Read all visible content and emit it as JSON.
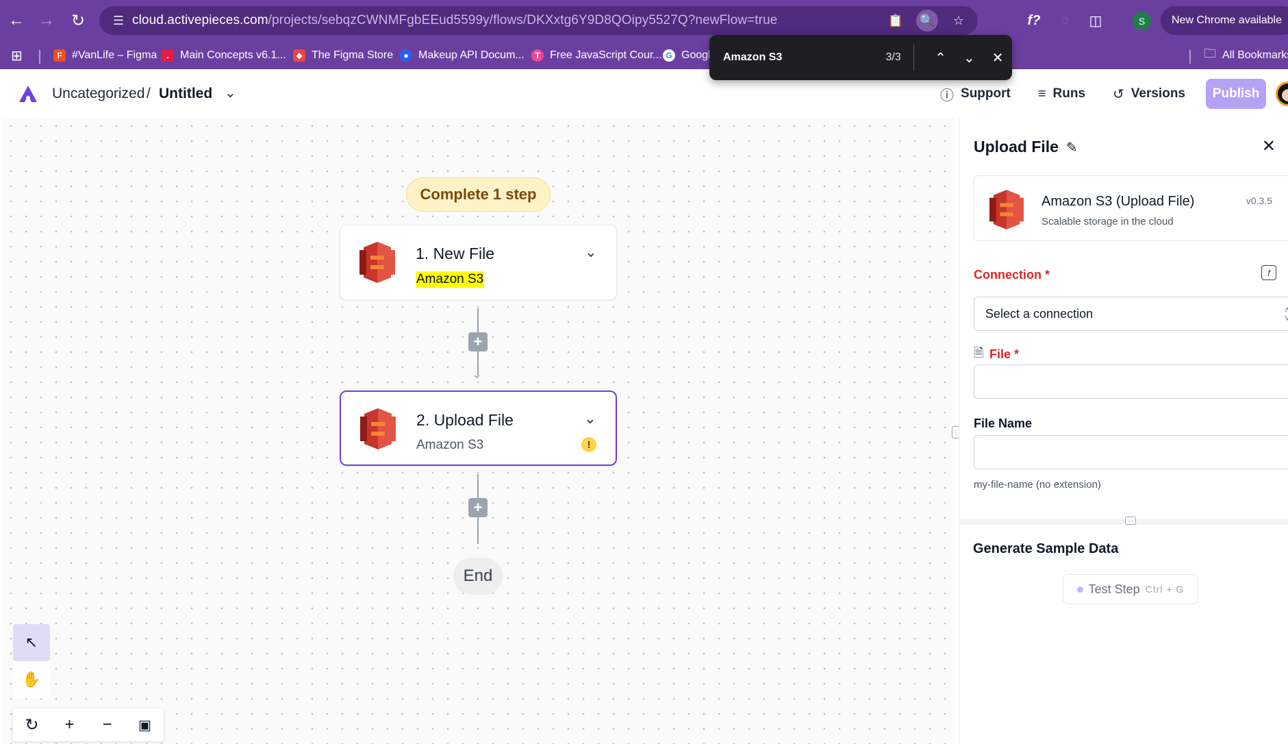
{
  "browser": {
    "url_host": "cloud.activepieces.com",
    "url_path": "/projects/sebqzCWNMFgbEEud5599y/flows/DKXxtg6Y9D8QOipy5527Q?newFlow=true",
    "new_chrome_label": "New Chrome available",
    "profile_initial": "S",
    "bookmarks": [
      {
        "label": "#VanLife – Figma",
        "color": "#f24e1e"
      },
      {
        "label": "Main Concepts v6.1...",
        "color": "#e11d48"
      },
      {
        "label": "The Figma Store",
        "color": "#ef4444"
      },
      {
        "label": "Makeup API Docum...",
        "color": "#2563eb"
      },
      {
        "label": "Free JavaScript Cour...",
        "color": "#ec4899"
      },
      {
        "label": "Googl",
        "color": "#ffffff"
      }
    ],
    "all_bookmarks_label": "All Bookmarks"
  },
  "findbar": {
    "query": "Amazon S3",
    "count": "3/3"
  },
  "header": {
    "breadcrumb_folder": "Uncategorized",
    "breadcrumb_sep": "/",
    "flow_name": "Untitled",
    "support_label": "Support",
    "runs_label": "Runs",
    "versions_label": "Versions",
    "publish_label": "Publish"
  },
  "canvas": {
    "complete_pill": "Complete 1 step",
    "steps": [
      {
        "title": "1. New File",
        "subtitle": "Amazon S3"
      },
      {
        "title": "2. Upload File",
        "subtitle": "Amazon S3"
      }
    ],
    "end_label": "End"
  },
  "panel": {
    "title": "Upload File",
    "piece_name": "Amazon S3 (Upload File)",
    "piece_desc": "Scalable storage in the cloud",
    "piece_version": "v0.3.5",
    "connection_label": "Connection",
    "connection_placeholder": "Select a connection",
    "file_label": "File",
    "required_mark": "*",
    "file_name_label": "File Name",
    "file_name_helper": "my-file-name (no extension)",
    "generate_title": "Generate Sample Data",
    "test_step_label": "Test Step",
    "test_step_shortcut": "Ctrl + G"
  }
}
